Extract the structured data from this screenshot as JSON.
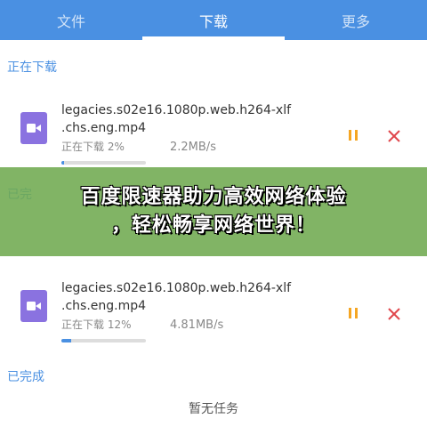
{
  "tabs": [
    {
      "label": "文件",
      "active": false
    },
    {
      "label": "下载",
      "active": true
    },
    {
      "label": "更多",
      "active": false
    }
  ],
  "downloading_header": "正在下载",
  "completed_header_partial": "已完",
  "completed_header": "已完成",
  "downloads": [
    {
      "filename_line1": "legacies.s02e16.1080p.web.h264-xlf",
      "filename_line2": ".chs.eng.mp4",
      "status": "正在下载 2%",
      "speed": "2.2MB/s",
      "progress": 2,
      "icon": "video-icon"
    },
    {
      "filename_line1": "legacies.s02e16.1080p.web.h264-xlf",
      "filename_line2": ".chs.eng.mp4",
      "status": "正在下载 12%",
      "speed": "4.81MB/s",
      "progress": 12,
      "icon": "video-icon"
    }
  ],
  "banner": {
    "line1": "百度限速器助力高效网络体验",
    "line2": "，轻松畅享网络世界！"
  },
  "empty_message": "暂无任务",
  "colors": {
    "accent": "#4a90e2",
    "file_icon": "#8a72e0",
    "pause": "#f5a623",
    "close": "#e0464b",
    "banner": "#6faa50"
  }
}
